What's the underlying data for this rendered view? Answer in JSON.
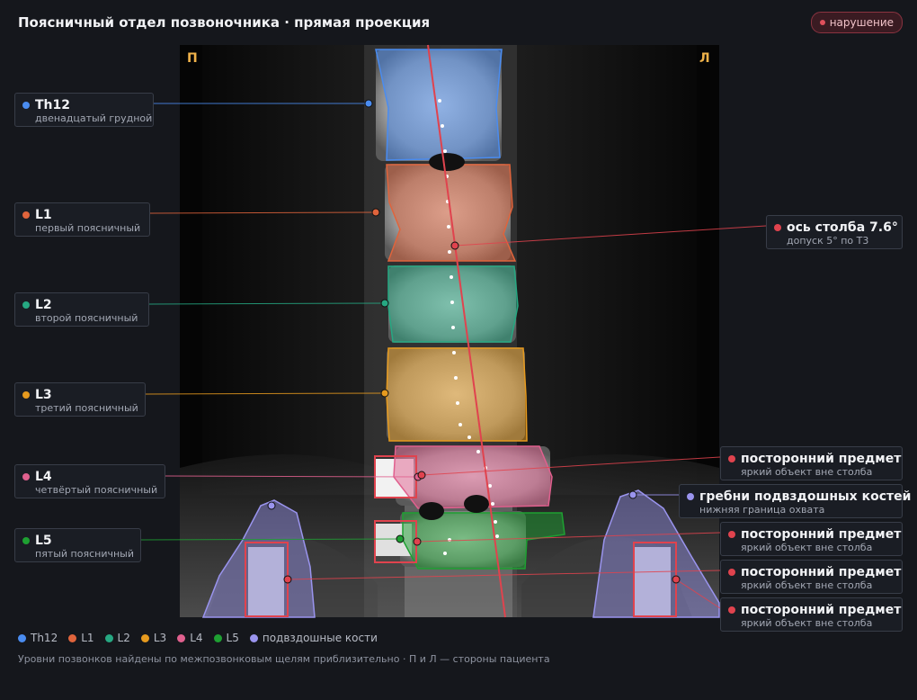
{
  "header": {
    "title": "Поясничный отдел позвоночника · прямая проекция",
    "badge": "нарушение"
  },
  "image": {
    "side_left": "П",
    "side_right": "Л"
  },
  "colors": {
    "Th12": "#4a8cf0",
    "L1": "#e0643c",
    "L2": "#26a882",
    "L3": "#e69a1e",
    "L4": "#e0608e",
    "L5": "#1ea032",
    "iliac": "#9a94ee",
    "alert": "#e0434e"
  },
  "vertebrae": [
    {
      "id": "Th12",
      "name": "Th12",
      "desc": "двенадцатый грудной"
    },
    {
      "id": "L1",
      "name": "L1",
      "desc": "первый поясничный"
    },
    {
      "id": "L2",
      "name": "L2",
      "desc": "второй поясничный"
    },
    {
      "id": "L3",
      "name": "L3",
      "desc": "третий поясничный"
    },
    {
      "id": "L4",
      "name": "L4",
      "desc": "четвёртый поясничный"
    },
    {
      "id": "L5",
      "name": "L5",
      "desc": "пятый поясничный"
    }
  ],
  "axis": {
    "title": "ось столба 7.6°",
    "desc": "допуск 5° по Т3"
  },
  "iliac": {
    "title": "гребни подвздошных костей",
    "desc": "нижняя граница охвата"
  },
  "foreign_objects": [
    {
      "title": "посторонний предмет",
      "desc": "яркий объект вне столба"
    },
    {
      "title": "посторонний предмет",
      "desc": "яркий объект вне столба"
    },
    {
      "title": "посторонний предмет",
      "desc": "яркий объект вне столба"
    },
    {
      "title": "посторонний предмет",
      "desc": "яркий объект вне столба"
    }
  ],
  "legend": [
    {
      "id": "Th12",
      "label": "Th12"
    },
    {
      "id": "L1",
      "label": "L1"
    },
    {
      "id": "L2",
      "label": "L2"
    },
    {
      "id": "L3",
      "label": "L3"
    },
    {
      "id": "L4",
      "label": "L4"
    },
    {
      "id": "L5",
      "label": "L5"
    },
    {
      "id": "iliac",
      "label": "подвздошные кости"
    }
  ],
  "footnote": "Уровни позвонков найдены по межпозвонковым щелям приблизительно · П и Л — стороны пациента"
}
